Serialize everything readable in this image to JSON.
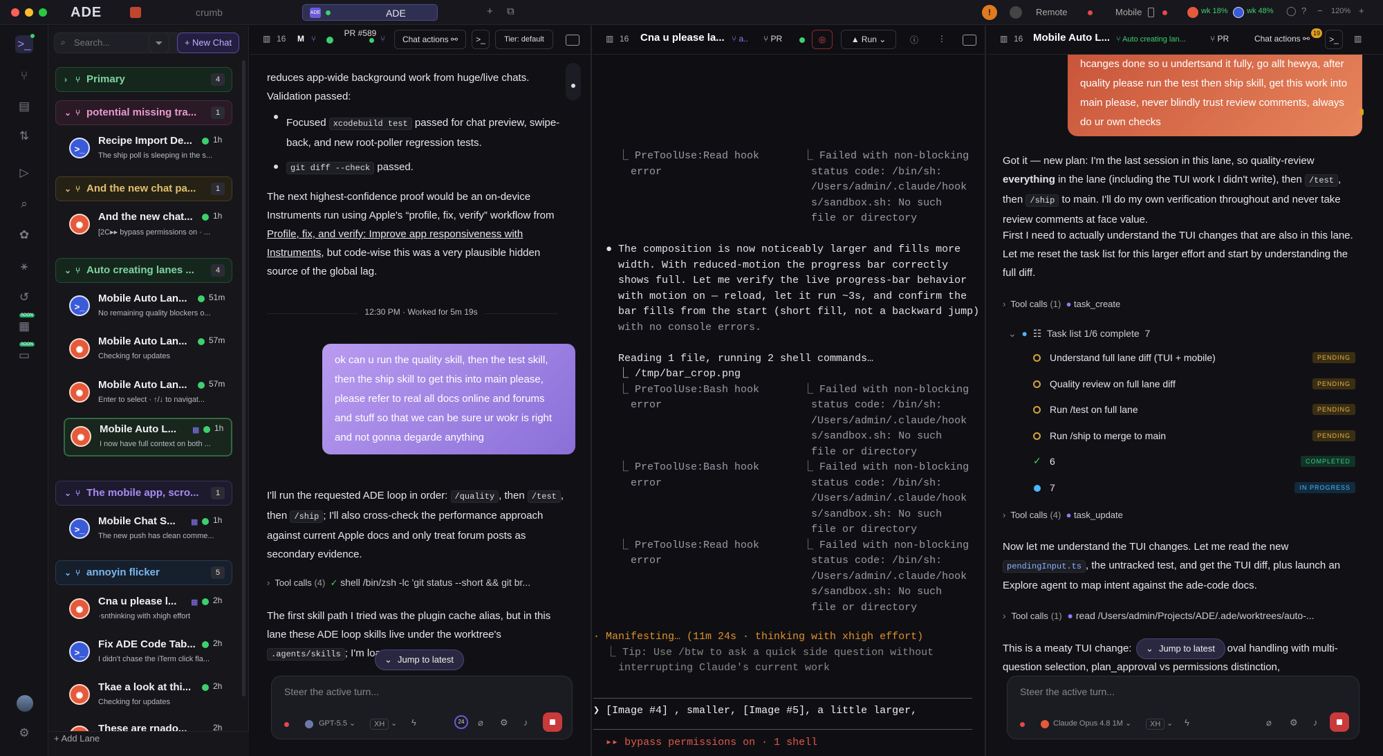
{
  "topbar": {
    "brand": "ADE",
    "crumb": "crumb",
    "active_tab_badge": "ADE",
    "active_tab": "ADE",
    "remote_label": "Remote",
    "mobile_label": "Mobile",
    "stat1": "wk 18%",
    "stat2": "wk 48%",
    "zoom": "120%",
    "colors": {
      "close": "#ff5f57",
      "minimize": "#febc2e",
      "maximize": "#28c840",
      "accent": "#7b6cf0"
    }
  },
  "rail": {
    "soon1": "SOON",
    "soon2": "SOON"
  },
  "lanes": {
    "search_placeholder": "Search...",
    "new_chat": "+ New Chat",
    "add_lane": "+ Add Lane",
    "groups": [
      {
        "name": "Primary",
        "count": "4",
        "color": "#7fd3a0"
      },
      {
        "name": "potential missing tra...",
        "count": "1",
        "color": "#e89ad0"
      },
      {
        "name": "And the new chat pa...",
        "count": "1",
        "color": "#e0c070"
      },
      {
        "name": "Auto creating lanes ...",
        "count": "4",
        "color": "#7fd3a0"
      },
      {
        "name": "The mobile app, scro...",
        "count": "1",
        "color": "#a88bf0"
      },
      {
        "name": "annoyin flicker",
        "count": "5",
        "color": "#7ab8f0"
      }
    ],
    "items": [
      {
        "title": "Recipe Import De...",
        "desc": "The ship poll is sleeping in the s...",
        "time": "1h"
      },
      {
        "title": "And the new chat...",
        "desc": "[2C▸▸ bypass permissions on · ...",
        "time": "1h"
      },
      {
        "title": "Mobile Auto Lan...",
        "desc": "No remaining quality blockers o...",
        "time": "51m"
      },
      {
        "title": "Mobile Auto Lan...",
        "desc": "Checking for updates",
        "time": "57m"
      },
      {
        "title": "Mobile Auto Lan...",
        "desc": "Enter to select · ↑/↓ to navigat...",
        "time": "57m"
      },
      {
        "title": "Mobile Auto L...",
        "desc": "I now have full context on both ...",
        "time": "1h"
      },
      {
        "title": "Mobile Chat S...",
        "desc": "The new push has clean comme...",
        "time": "1h"
      },
      {
        "title": "Cna u please l...",
        "desc": "·snthinking with xhigh effort",
        "time": "2h"
      },
      {
        "title": "Fix ADE Code Tab...",
        "desc": "I didn't chase the iTerm click fla...",
        "time": "2h"
      },
      {
        "title": "Tkae a look at thi...",
        "desc": "Checking for updates",
        "time": "2h"
      },
      {
        "title": "These are rnado...",
        "desc": "",
        "time": "2h"
      }
    ]
  },
  "pane1": {
    "count": "16",
    "pr": "PR #589",
    "chat_actions": "Chat actions",
    "tier": "Tier: default",
    "p1": "reduces app-wide background work from huge/live chats. Validation passed:",
    "b1a": "Focused ",
    "b1code": "xcodebuild test",
    "b1b": " passed for chat preview, swipe-back, and new root-poller regression tests.",
    "b2code": "git diff --check",
    "b2b": " passed.",
    "p2a": "The next highest-confidence proof would be an on-device Instruments run using Apple's “profile, fix, verify” workflow from ",
    "p2link": "Profile, fix, and verify: Improve app responsiveness with Instruments",
    "p2b": ", but code-wise this was a very plausible hidden source of the global lag.",
    "timestamp": "12:30 PM",
    "worked": "Worked for 5m 19s",
    "user_msg": "ok can u run the quality skill, then the test skill, then the ship skill to get this into main please, please refer to real all docs online and forums and stuff so that we can be sure ur wokr is right and not gonna degarde anything",
    "p3a": "I'll run the requested ADE loop in order: ",
    "p3c1": "/quality",
    "p3b": ", then ",
    "p3c2": "/test",
    "p3c": ", then ",
    "p3c3": "/ship",
    "p3d": "; I'll also cross-check the performance approach against current Apple docs and only treat forum posts as secondary evidence.",
    "tool_label": "Tool calls",
    "tool_count": "(4)",
    "tool_cmd": "shell  /bin/zsh -lc 'git status --short && git br...",
    "p4a": "The first skill path I tried was the plugin cache alias, but in this lane these ADE loop skills live under the worktree's ",
    "p4code": ".agents/skills",
    "p4b": "; I'm loa",
    "jump": "Jump to latest",
    "composer_ph": "Steer the active turn...",
    "model": "GPT-5.5",
    "effort": "XH",
    "ctx": "24"
  },
  "pane2": {
    "count": "16",
    "title": "Cna u please la...",
    "pr": "PR",
    "run": "Run",
    "log": [
      "  ⎿ PreToolUse:Read hook       ⎿ Failed with non-blocking",
      "    error                        status code: /bin/sh:",
      "                                 /Users/admin/.claude/hook",
      "                                 s/sandbox.sh: No such",
      "                                 file or directory",
      "",
      "● The composition is now noticeably larger and fills more",
      "  width. With reduced-motion the progress bar correctly",
      "  shows full. Let me verify the live progress-bar behavior",
      "  with motion on — reload, let it run ~3s, and confirm the",
      "  bar fills from the start (short fill, not a backward jump)",
      "  with no console errors.",
      "",
      "  Reading 1 file, running 2 shell commands…",
      "  ⎿ /tmp/bar_crop.png",
      "  ⎿ PreToolUse:Bash hook       ⎿ Failed with non-blocking",
      "    error                        status code: /bin/sh:",
      "                                 /Users/admin/.claude/hook",
      "                                 s/sandbox.sh: No such",
      "                                 file or directory",
      "  ⎿ PreToolUse:Bash hook       ⎿ Failed with non-blocking",
      "    error                        status code: /bin/sh:",
      "                                 /Users/admin/.claude/hook",
      "                                 s/sandbox.sh: No such",
      "                                 file or directory",
      "  ⎿ PreToolUse:Read hook       ⎿ Failed with non-blocking",
      "    error                        status code: /bin/sh:",
      "                                 /Users/admin/.claude/hook",
      "                                 s/sandbox.sh: No such",
      "                                 file or directory"
    ],
    "manifest": "· Manifesting… (11m 24s · thinking with xhigh effort)",
    "tip1": "  ⎿ Tip: Use /btw to ask a quick side question without",
    "tip2": "    interrupting Claude's current work",
    "prompt": "❯ [Image #4] , smaller, [Image #5], a little larger,",
    "bypass": "▸▸ bypass permissions on · 1 shell"
  },
  "pane3": {
    "count": "16",
    "title": "Mobile Auto L...",
    "subtitle": "Auto creating lan...",
    "pr": "PR",
    "chat_actions": "Chat actions",
    "notif": "19",
    "user_msg": "hcanges done so u undertsand it fully, go allt hewya, after quality please run the test then ship skill, get this work into main please, never blindly trust review comments, always do ur own checks",
    "p1a": "Got it — new plan: I'm the last session in this lane, so quality-review ",
    "p1b": "everything",
    "p1c": " in the lane (including the TUI work I didn't write), then ",
    "p1code1": "/test",
    "p1d": ", then ",
    "p1code2": "/ship",
    "p1e": " to main. I'll do my own verification throughout and never take review comments at face value.",
    "p2": "First I need to actually understand the TUI changes that are also in this lane. Let me reset the task list for this larger effort and start by understanding the full diff.",
    "tool1": "Tool calls",
    "tool1c": "(1)",
    "tool1n": "task_create",
    "tasklist": "Task list 1/6 complete",
    "tasklist_n": "7",
    "tasks": [
      {
        "text": "Understand full lane diff (TUI + mobile)",
        "status": "PENDING"
      },
      {
        "text": "Quality review on full lane diff",
        "status": "PENDING"
      },
      {
        "text": "Run /test on full lane",
        "status": "PENDING"
      },
      {
        "text": "Run /ship to merge to main",
        "status": "PENDING"
      },
      {
        "text": "6",
        "status": "COMPLETED"
      },
      {
        "text": "7",
        "status": "IN PROGRESS"
      }
    ],
    "tool2": "Tool calls",
    "tool2c": "(4)",
    "tool2n": "task_update",
    "p3a": "Now let me understand the TUI changes. Let me read the new ",
    "p3code": "pendingInput.ts",
    "p3b": ", the untracked test, and get the TUI diff, plus launch an Explore agent to map intent against the ade-code docs.",
    "tool3": "Tool calls",
    "tool3c": "(1)",
    "tool3n": "read  /Users/admin/Projects/ADE/.ade/worktrees/auto-...",
    "p4a": "This is a meaty TUI change: ",
    "p4b": "oval handling with multi-question selection, plan_approval vs permissions distinction,",
    "jump": "Jump to latest",
    "composer_ph": "Steer the active turn...",
    "model": "Claude Opus 4.8 1M",
    "effort": "XH"
  }
}
